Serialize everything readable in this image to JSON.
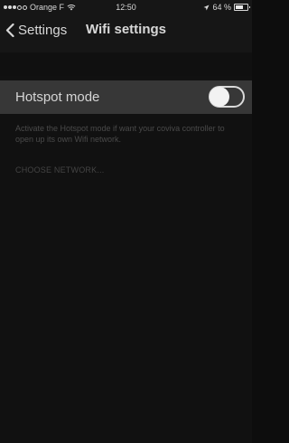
{
  "status_bar": {
    "carrier": "Orange F",
    "time": "12:50",
    "battery_percent_label": "64 %",
    "battery_level": 0.64,
    "signal_dots_filled": 3,
    "signal_dots_total": 5
  },
  "nav": {
    "back_label": "Settings",
    "title": "Wifi settings"
  },
  "hotspot": {
    "label": "Hotspot mode",
    "enabled": true,
    "description": "Activate the Hotspot mode if want your coviva controller to open up its own Wifi network."
  },
  "network": {
    "choose_label": "CHOOSE NETWORK..."
  },
  "colors": {
    "background": "#111111",
    "row_background": "#373737",
    "text_primary": "#d5d5d5",
    "text_muted": "#4a4a4a"
  },
  "icons": {
    "back": "chevron-left-icon",
    "wifi": "wifi-icon",
    "location": "location-arrow-icon",
    "battery": "battery-icon"
  }
}
